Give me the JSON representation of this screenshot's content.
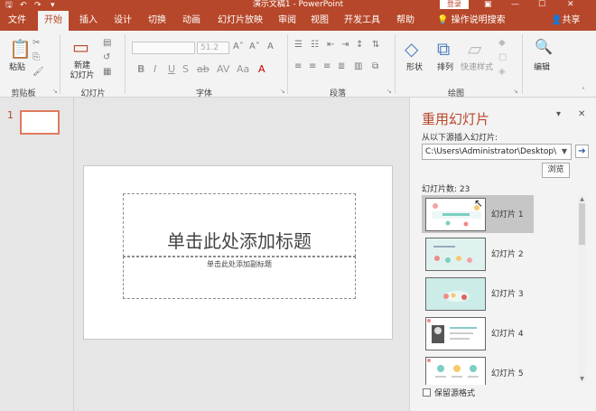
{
  "titlebar": {
    "doc_title": "演示文稿1 - PowerPoint",
    "login_label": "登录",
    "min_icon": "minimize-icon",
    "max_icon": "maximize-icon",
    "close_icon": "close-icon"
  },
  "tabs": [
    {
      "label": "文件"
    },
    {
      "label": "开始",
      "active": true
    },
    {
      "label": "插入"
    },
    {
      "label": "设计"
    },
    {
      "label": "切换"
    },
    {
      "label": "动画"
    },
    {
      "label": "幻灯片放映"
    },
    {
      "label": "审阅"
    },
    {
      "label": "视图"
    },
    {
      "label": "开发工具"
    },
    {
      "label": "帮助"
    }
  ],
  "tell_me": "操作说明搜索",
  "share": "共享",
  "ribbon": {
    "paste": "粘贴",
    "new_slide": "新建\n幻灯片",
    "font_size": "51.2",
    "shapes": "形状",
    "arrange": "排列",
    "quick_styles": "快速样式",
    "editing": "编辑",
    "groups": {
      "clipboard": "剪贴板",
      "slides": "幻灯片",
      "font": "字体",
      "paragraph": "段落",
      "drawing": "绘图"
    }
  },
  "thumbnails": {
    "number": "1"
  },
  "slide": {
    "title_placeholder": "单击此处添加标题",
    "subtitle_placeholder": "单击此处添加副标题"
  },
  "reuse_pane": {
    "title": "重用幻灯片",
    "insert_from_label": "从以下源插入幻灯片:",
    "path_value": "C:\\Users\\Administrator\\Desktop\\",
    "browse_label": "浏览",
    "count_label": "幻灯片数: 23",
    "slides": [
      {
        "label": "幻灯片 1",
        "selected": true
      },
      {
        "label": "幻灯片 2"
      },
      {
        "label": "幻灯片 3"
      },
      {
        "label": "幻灯片 4"
      },
      {
        "label": "幻灯片 5"
      }
    ],
    "keep_format_label": "保留源格式"
  },
  "colors": {
    "accent": "#b7472a",
    "ribbon_bg": "#f3f3f3",
    "workspace_bg": "#e6e6e6"
  }
}
